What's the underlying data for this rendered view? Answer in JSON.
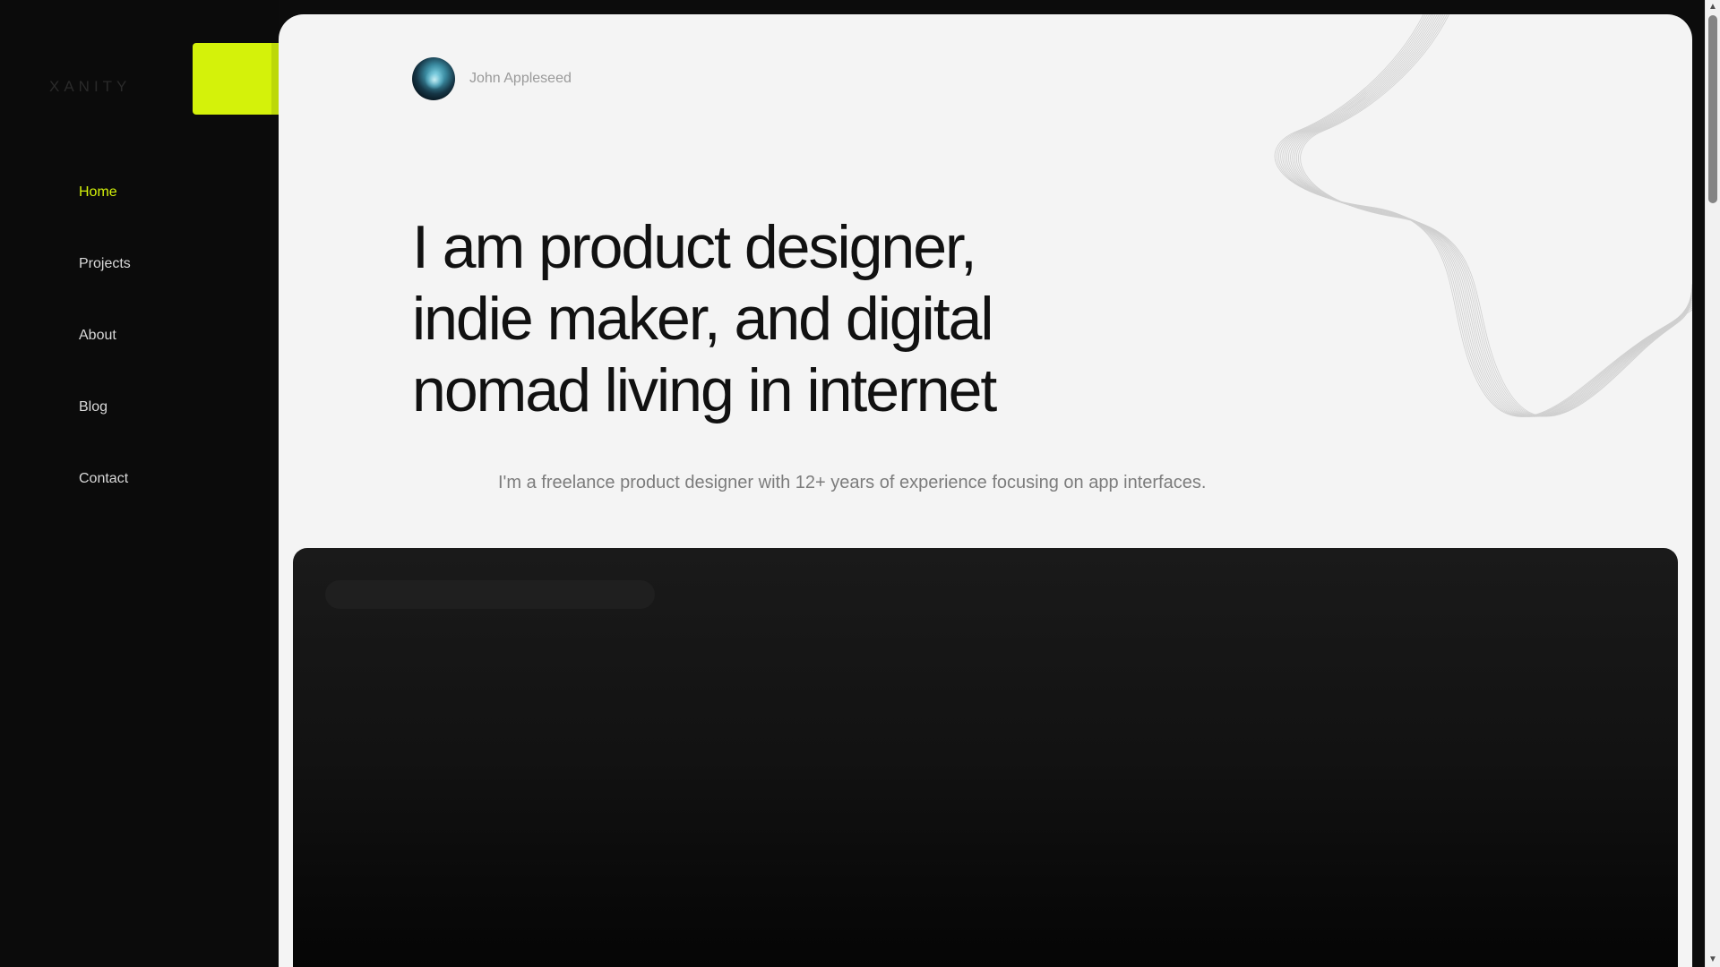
{
  "app": {
    "logo_text": "XANITY"
  },
  "sidebar": {
    "items": [
      {
        "label": "Home",
        "active": true
      },
      {
        "label": "Projects"
      },
      {
        "label": "About"
      },
      {
        "label": "Blog"
      },
      {
        "label": "Contact"
      }
    ]
  },
  "hero": {
    "author_name": "John Appleseed",
    "headline": "I am product designer, indie maker, and digital nomad living in internet",
    "intro": "I'm a freelance product designer with 12+ years of experience focusing on app interfaces."
  },
  "colors": {
    "accent": "#d4f20a",
    "sidebar_bg": "#0b0b0b",
    "hero_bg": "#f4f4f4",
    "panel_bg": "#1a1a1a"
  },
  "icons": {
    "avatar": "avatar-photo",
    "decoration": "wave-line-decoration",
    "scroll_up": "up-arrow-icon",
    "scroll_down": "down-arrow-icon"
  }
}
